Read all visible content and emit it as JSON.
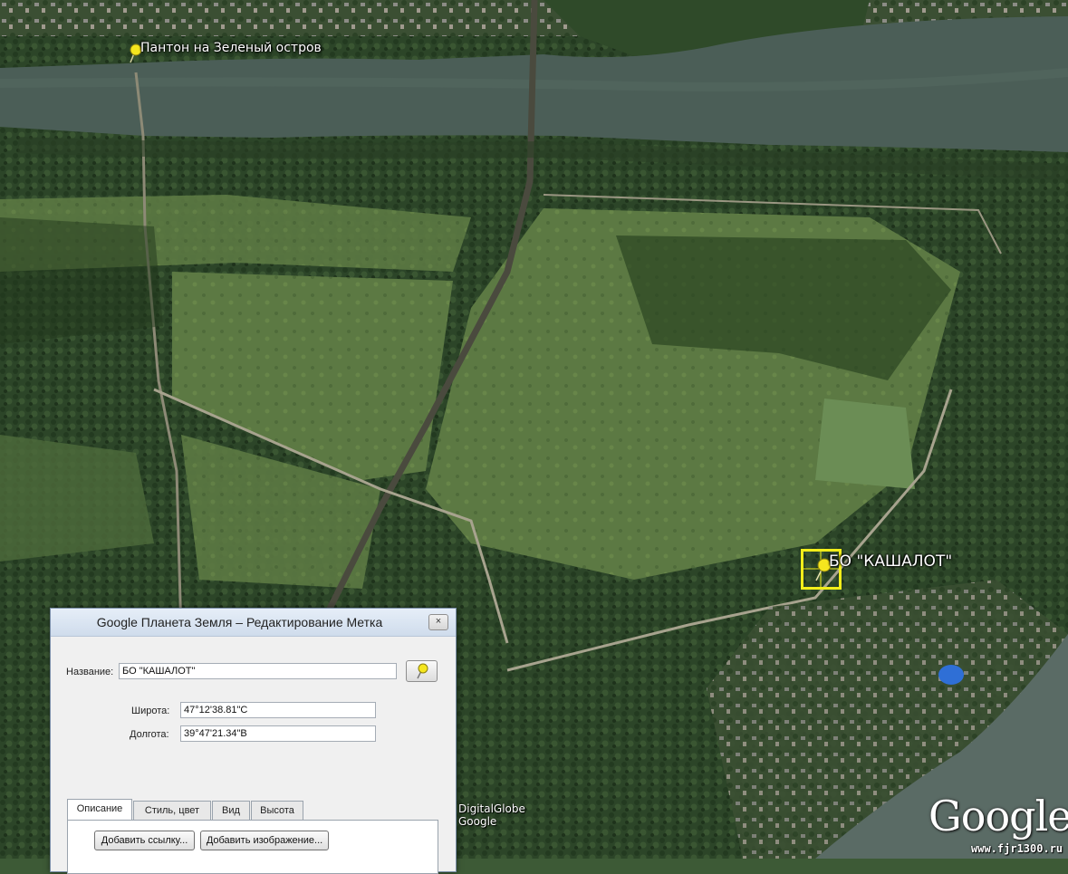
{
  "placemarks": [
    {
      "name": "Пантон на Зеленый остров"
    },
    {
      "name": "БО \"КАШАЛОТ\""
    }
  ],
  "dialog": {
    "title": "Google Планета Земля – Редактирование Метка",
    "close_glyph": "×",
    "name_label": "Название:",
    "name_value": "БО \"КАШАЛОТ\"",
    "lat_label": "Широта:",
    "lat_value": "47°12'38.81\"С",
    "lon_label": "Долгота:",
    "lon_value": "39°47'21.34\"В",
    "pin_icon": "pushpin-icon",
    "tabs": [
      "Описание",
      "Стиль, цвет",
      "Вид",
      "Высота"
    ],
    "active_tab": "Описание",
    "buttons": {
      "add_link": "Добавить ссылку...",
      "add_image": "Добавить изображение..."
    }
  },
  "credits": {
    "line1": "DigitalGlobe",
    "line2": "Google"
  },
  "logo": "Google",
  "watermark": "www.fjr1300.ru",
  "colors": {
    "pin": "#f5e61e",
    "selection": "#f2ee1a",
    "water": "#4b5e57",
    "forest": "#2a4226",
    "field": "#5d7a44"
  }
}
